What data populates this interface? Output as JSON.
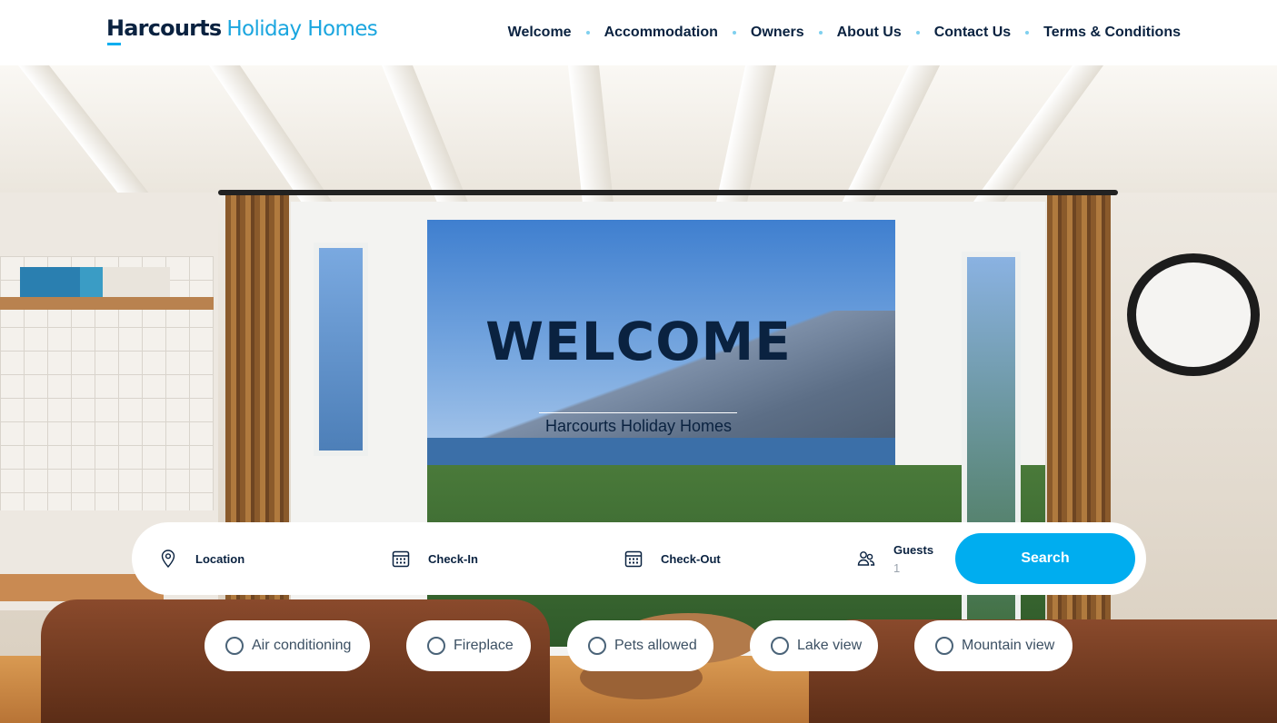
{
  "brand": {
    "name_main": "Harcourts",
    "name_sub": "Holiday Homes"
  },
  "nav": {
    "items": [
      "Welcome",
      "Accommodation",
      "Owners",
      "About Us",
      "Contact Us",
      "Terms & Conditions"
    ]
  },
  "hero": {
    "title": "WELCOME",
    "subtitle": "Harcourts Holiday Homes"
  },
  "search": {
    "location_label": "Location",
    "checkin_label": "Check-In",
    "checkout_label": "Check-Out",
    "guests_label": "Guests",
    "guests_value": "1",
    "button_label": "Search"
  },
  "filters": [
    "Air conditioning",
    "Fireplace",
    "Pets allowed",
    "Lake view",
    "Mountain view"
  ],
  "colors": {
    "navy": "#0a2240",
    "accent": "#00adef",
    "logo_sub": "#1ba6df"
  },
  "icons": {
    "location": "map-pin-icon",
    "checkin": "calendar-icon",
    "checkout": "calendar-icon",
    "guests": "users-icon"
  }
}
